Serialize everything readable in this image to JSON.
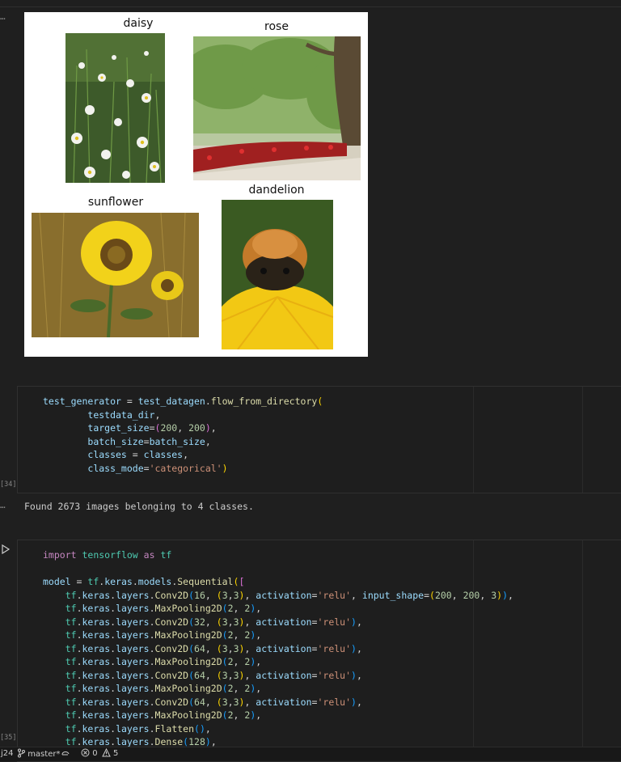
{
  "gutter": {
    "output_ellipsis": "…",
    "exec_counts": [
      "[34]",
      "[35]"
    ]
  },
  "figure": {
    "titles": [
      "daisy",
      "rose",
      "sunflower",
      "dandelion"
    ]
  },
  "cell_34": {
    "lines": [
      [
        [
          "var",
          "test_generator"
        ],
        [
          "p",
          " = "
        ],
        [
          "var",
          "test_datagen"
        ],
        [
          "p",
          "."
        ],
        [
          "fn",
          "flow_from_directory"
        ],
        [
          "br1",
          "("
        ]
      ],
      [
        [
          "p",
          "        "
        ],
        [
          "var",
          "testdata_dir"
        ],
        [
          "p",
          ","
        ]
      ],
      [
        [
          "p",
          "        "
        ],
        [
          "var",
          "target_size"
        ],
        [
          "p",
          "="
        ],
        [
          "br2",
          "("
        ],
        [
          "num",
          "200"
        ],
        [
          "p",
          ", "
        ],
        [
          "num",
          "200"
        ],
        [
          "br2",
          ")"
        ],
        [
          "p",
          ","
        ]
      ],
      [
        [
          "p",
          "        "
        ],
        [
          "var",
          "batch_size"
        ],
        [
          "p",
          "="
        ],
        [
          "var",
          "batch_size"
        ],
        [
          "p",
          ","
        ]
      ],
      [
        [
          "p",
          "        "
        ],
        [
          "var",
          "classes"
        ],
        [
          "p",
          " = "
        ],
        [
          "var",
          "classes"
        ],
        [
          "p",
          ","
        ]
      ],
      [
        [
          "p",
          "        "
        ],
        [
          "var",
          "class_mode"
        ],
        [
          "p",
          "="
        ],
        [
          "str",
          "'categorical'"
        ],
        [
          "br1",
          ")"
        ]
      ]
    ]
  },
  "output_34": "Found 2673 images belonging to 4 classes.",
  "cell_35": {
    "lines": [
      [
        [
          "kw",
          "import"
        ],
        [
          "p",
          " "
        ],
        [
          "mod",
          "tensorflow"
        ],
        [
          "p",
          " "
        ],
        [
          "kw",
          "as"
        ],
        [
          "p",
          " "
        ],
        [
          "mod",
          "tf"
        ]
      ],
      [],
      [
        [
          "var",
          "model"
        ],
        [
          "p",
          " = "
        ],
        [
          "mod",
          "tf"
        ],
        [
          "p",
          "."
        ],
        [
          "var",
          "keras"
        ],
        [
          "p",
          "."
        ],
        [
          "var",
          "models"
        ],
        [
          "p",
          "."
        ],
        [
          "fn",
          "Sequential"
        ],
        [
          "br1",
          "("
        ],
        [
          "br2",
          "["
        ]
      ],
      [
        [
          "p",
          "    "
        ],
        [
          "mod",
          "tf"
        ],
        [
          "p",
          "."
        ],
        [
          "var",
          "keras"
        ],
        [
          "p",
          "."
        ],
        [
          "var",
          "layers"
        ],
        [
          "p",
          "."
        ],
        [
          "fn",
          "Conv2D"
        ],
        [
          "br3",
          "("
        ],
        [
          "num",
          "16"
        ],
        [
          "p",
          ", "
        ],
        [
          "br1",
          "("
        ],
        [
          "num",
          "3"
        ],
        [
          "p",
          ","
        ],
        [
          "num",
          "3"
        ],
        [
          "br1",
          ")"
        ],
        [
          "p",
          ", "
        ],
        [
          "var",
          "activation"
        ],
        [
          "p",
          "="
        ],
        [
          "str",
          "'relu'"
        ],
        [
          "p",
          ", "
        ],
        [
          "var",
          "input_shape"
        ],
        [
          "p",
          "="
        ],
        [
          "br1",
          "("
        ],
        [
          "num",
          "200"
        ],
        [
          "p",
          ", "
        ],
        [
          "num",
          "200"
        ],
        [
          "p",
          ", "
        ],
        [
          "num",
          "3"
        ],
        [
          "br1",
          ")"
        ],
        [
          "br3",
          ")"
        ],
        [
          "p",
          ","
        ]
      ],
      [
        [
          "p",
          "    "
        ],
        [
          "mod",
          "tf"
        ],
        [
          "p",
          "."
        ],
        [
          "var",
          "keras"
        ],
        [
          "p",
          "."
        ],
        [
          "var",
          "layers"
        ],
        [
          "p",
          "."
        ],
        [
          "fn",
          "MaxPooling2D"
        ],
        [
          "br3",
          "("
        ],
        [
          "num",
          "2"
        ],
        [
          "p",
          ", "
        ],
        [
          "num",
          "2"
        ],
        [
          "br3",
          ")"
        ],
        [
          "p",
          ","
        ]
      ],
      [
        [
          "p",
          "    "
        ],
        [
          "mod",
          "tf"
        ],
        [
          "p",
          "."
        ],
        [
          "var",
          "keras"
        ],
        [
          "p",
          "."
        ],
        [
          "var",
          "layers"
        ],
        [
          "p",
          "."
        ],
        [
          "fn",
          "Conv2D"
        ],
        [
          "br3",
          "("
        ],
        [
          "num",
          "32"
        ],
        [
          "p",
          ", "
        ],
        [
          "br1",
          "("
        ],
        [
          "num",
          "3"
        ],
        [
          "p",
          ","
        ],
        [
          "num",
          "3"
        ],
        [
          "br1",
          ")"
        ],
        [
          "p",
          ", "
        ],
        [
          "var",
          "activation"
        ],
        [
          "p",
          "="
        ],
        [
          "str",
          "'relu'"
        ],
        [
          "br3",
          ")"
        ],
        [
          "p",
          ","
        ]
      ],
      [
        [
          "p",
          "    "
        ],
        [
          "mod",
          "tf"
        ],
        [
          "p",
          "."
        ],
        [
          "var",
          "keras"
        ],
        [
          "p",
          "."
        ],
        [
          "var",
          "layers"
        ],
        [
          "p",
          "."
        ],
        [
          "fn",
          "MaxPooling2D"
        ],
        [
          "br3",
          "("
        ],
        [
          "num",
          "2"
        ],
        [
          "p",
          ", "
        ],
        [
          "num",
          "2"
        ],
        [
          "br3",
          ")"
        ],
        [
          "p",
          ","
        ]
      ],
      [
        [
          "p",
          "    "
        ],
        [
          "mod",
          "tf"
        ],
        [
          "p",
          "."
        ],
        [
          "var",
          "keras"
        ],
        [
          "p",
          "."
        ],
        [
          "var",
          "layers"
        ],
        [
          "p",
          "."
        ],
        [
          "fn",
          "Conv2D"
        ],
        [
          "br3",
          "("
        ],
        [
          "num",
          "64"
        ],
        [
          "p",
          ", "
        ],
        [
          "br1",
          "("
        ],
        [
          "num",
          "3"
        ],
        [
          "p",
          ","
        ],
        [
          "num",
          "3"
        ],
        [
          "br1",
          ")"
        ],
        [
          "p",
          ", "
        ],
        [
          "var",
          "activation"
        ],
        [
          "p",
          "="
        ],
        [
          "str",
          "'relu'"
        ],
        [
          "br3",
          ")"
        ],
        [
          "p",
          ","
        ]
      ],
      [
        [
          "p",
          "    "
        ],
        [
          "mod",
          "tf"
        ],
        [
          "p",
          "."
        ],
        [
          "var",
          "keras"
        ],
        [
          "p",
          "."
        ],
        [
          "var",
          "layers"
        ],
        [
          "p",
          "."
        ],
        [
          "fn",
          "MaxPooling2D"
        ],
        [
          "br3",
          "("
        ],
        [
          "num",
          "2"
        ],
        [
          "p",
          ", "
        ],
        [
          "num",
          "2"
        ],
        [
          "br3",
          ")"
        ],
        [
          "p",
          ","
        ]
      ],
      [
        [
          "p",
          "    "
        ],
        [
          "mod",
          "tf"
        ],
        [
          "p",
          "."
        ],
        [
          "var",
          "keras"
        ],
        [
          "p",
          "."
        ],
        [
          "var",
          "layers"
        ],
        [
          "p",
          "."
        ],
        [
          "fn",
          "Conv2D"
        ],
        [
          "br3",
          "("
        ],
        [
          "num",
          "64"
        ],
        [
          "p",
          ", "
        ],
        [
          "br1",
          "("
        ],
        [
          "num",
          "3"
        ],
        [
          "p",
          ","
        ],
        [
          "num",
          "3"
        ],
        [
          "br1",
          ")"
        ],
        [
          "p",
          ", "
        ],
        [
          "var",
          "activation"
        ],
        [
          "p",
          "="
        ],
        [
          "str",
          "'relu'"
        ],
        [
          "br3",
          ")"
        ],
        [
          "p",
          ","
        ]
      ],
      [
        [
          "p",
          "    "
        ],
        [
          "mod",
          "tf"
        ],
        [
          "p",
          "."
        ],
        [
          "var",
          "keras"
        ],
        [
          "p",
          "."
        ],
        [
          "var",
          "layers"
        ],
        [
          "p",
          "."
        ],
        [
          "fn",
          "MaxPooling2D"
        ],
        [
          "br3",
          "("
        ],
        [
          "num",
          "2"
        ],
        [
          "p",
          ", "
        ],
        [
          "num",
          "2"
        ],
        [
          "br3",
          ")"
        ],
        [
          "p",
          ","
        ]
      ],
      [
        [
          "p",
          "    "
        ],
        [
          "mod",
          "tf"
        ],
        [
          "p",
          "."
        ],
        [
          "var",
          "keras"
        ],
        [
          "p",
          "."
        ],
        [
          "var",
          "layers"
        ],
        [
          "p",
          "."
        ],
        [
          "fn",
          "Conv2D"
        ],
        [
          "br3",
          "("
        ],
        [
          "num",
          "64"
        ],
        [
          "p",
          ", "
        ],
        [
          "br1",
          "("
        ],
        [
          "num",
          "3"
        ],
        [
          "p",
          ","
        ],
        [
          "num",
          "3"
        ],
        [
          "br1",
          ")"
        ],
        [
          "p",
          ", "
        ],
        [
          "var",
          "activation"
        ],
        [
          "p",
          "="
        ],
        [
          "str",
          "'relu'"
        ],
        [
          "br3",
          ")"
        ],
        [
          "p",
          ","
        ]
      ],
      [
        [
          "p",
          "    "
        ],
        [
          "mod",
          "tf"
        ],
        [
          "p",
          "."
        ],
        [
          "var",
          "keras"
        ],
        [
          "p",
          "."
        ],
        [
          "var",
          "layers"
        ],
        [
          "p",
          "."
        ],
        [
          "fn",
          "MaxPooling2D"
        ],
        [
          "br3",
          "("
        ],
        [
          "num",
          "2"
        ],
        [
          "p",
          ", "
        ],
        [
          "num",
          "2"
        ],
        [
          "br3",
          ")"
        ],
        [
          "p",
          ","
        ]
      ],
      [
        [
          "p",
          "    "
        ],
        [
          "mod",
          "tf"
        ],
        [
          "p",
          "."
        ],
        [
          "var",
          "keras"
        ],
        [
          "p",
          "."
        ],
        [
          "var",
          "layers"
        ],
        [
          "p",
          "."
        ],
        [
          "fn",
          "Flatten"
        ],
        [
          "br3",
          "("
        ],
        [
          "br3",
          ")"
        ],
        [
          "p",
          ","
        ]
      ],
      [
        [
          "p",
          "    "
        ],
        [
          "mod",
          "tf"
        ],
        [
          "p",
          "."
        ],
        [
          "var",
          "keras"
        ],
        [
          "p",
          "."
        ],
        [
          "var",
          "layers"
        ],
        [
          "p",
          "."
        ],
        [
          "fn",
          "Dense"
        ],
        [
          "br3",
          "("
        ],
        [
          "num",
          "128"
        ],
        [
          "br3",
          ")"
        ],
        [
          "p",
          ","
        ]
      ]
    ]
  },
  "statusbar": {
    "left_fragment": "j24",
    "branch": "master*",
    "errors": "0",
    "warnings": "5"
  }
}
